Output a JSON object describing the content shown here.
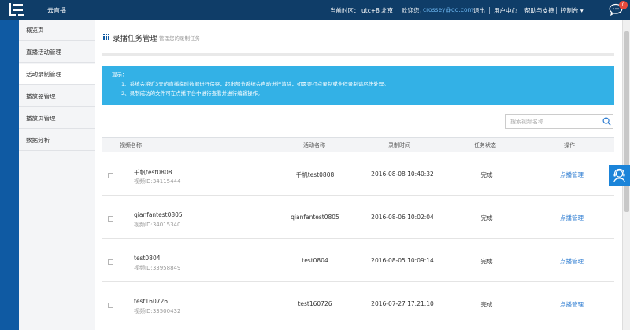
{
  "app": {
    "name": "云直播"
  },
  "header": {
    "timezone_label": "当前时区：",
    "timezone_value": "utc+8 北京",
    "welcome_label": "欢迎您，",
    "email": "crossey@qq.com",
    "logout": "退出",
    "user_center": "用户中心",
    "help": "帮助与支持",
    "console": "控制台 ▾",
    "chat_badge": "0"
  },
  "sidebar": {
    "items": [
      {
        "label": "概览页"
      },
      {
        "label": "直播活动管理"
      },
      {
        "label": "活动录制管理"
      },
      {
        "label": "播放器管理"
      },
      {
        "label": "播放页管理"
      },
      {
        "label": "数据分析"
      }
    ]
  },
  "page": {
    "title": "录播任务管理",
    "subtitle": "管理您的录制任务"
  },
  "notice": {
    "heading": "提示：",
    "lines": [
      "1、系统会将近3天的直播临时数据进行保存，超出部分系统会自动进行清除，如需要打点录制或全程录制请尽快处理。",
      "2、录制成功的文件可在点播平台中进行查看并进行编辑操作。"
    ]
  },
  "search": {
    "placeholder": "搜索视频名称"
  },
  "table": {
    "headers": [
      "视频名称",
      "活动名称",
      "录制时间",
      "任务状态",
      "操作"
    ],
    "rows": [
      {
        "video_name": "千帆test0808",
        "video_id": "视频ID:34115444",
        "activity": "千帆test0808",
        "time": "2016-08-08 10:40:32",
        "status": "完成",
        "action": "点播管理"
      },
      {
        "video_name": "qianfantest0805",
        "video_id": "视频ID:34015340",
        "activity": "qianfantest0805",
        "time": "2016-08-06 10:02:04",
        "status": "完成",
        "action": "点播管理"
      },
      {
        "video_name": "test0804",
        "video_id": "视频ID:33958849",
        "activity": "test0804",
        "time": "2016-08-05 10:09:14",
        "status": "完成",
        "action": "点播管理"
      },
      {
        "video_name": "test160726",
        "video_id": "视频ID:33500432",
        "activity": "test160726",
        "time": "2016-07-27 17:21:10",
        "status": "完成",
        "action": "点播管理"
      }
    ]
  },
  "colors": {
    "topbar": "#0f3d68",
    "sidebar_strip": "#0f5aa3",
    "notice_bg": "#33b1e6",
    "link": "#2a7ad0",
    "badge": "#e64a3c"
  },
  "icons": {
    "logo": "letv-logo-icon",
    "chat": "chat-bubble-icon",
    "grid": "grid-icon",
    "search": "search-icon",
    "service": "customer-service-icon"
  }
}
